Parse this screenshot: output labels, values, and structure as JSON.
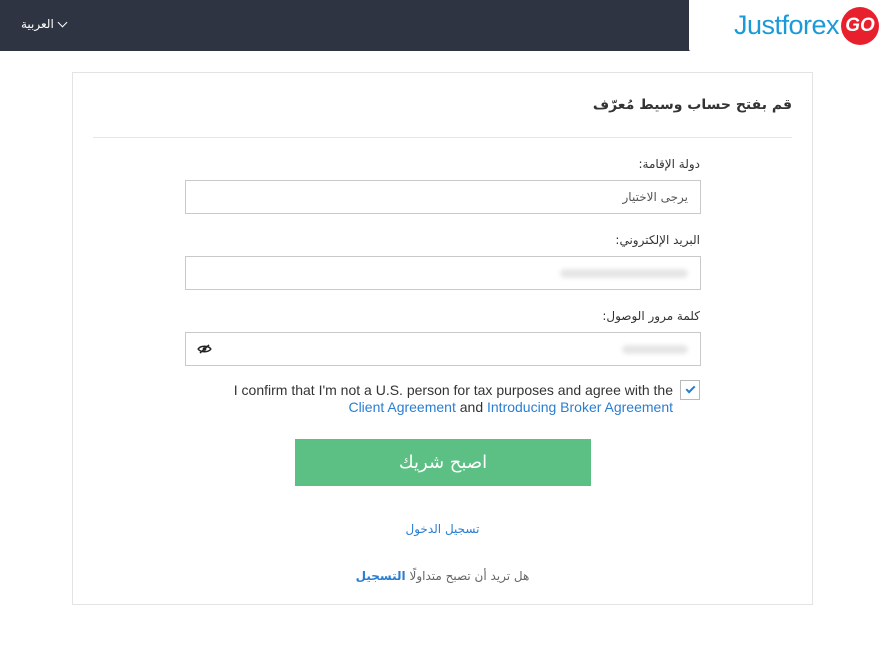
{
  "header": {
    "language": "العربية",
    "logo_text": "Justforex",
    "logo_badge": "GO",
    "brand_color": "#1a9bd7",
    "badge_color": "#e8202e",
    "bar_color": "#2e3441"
  },
  "form": {
    "title": "قم بفتح حساب وسيط مُعرّف",
    "country": {
      "label": "دولة الإقامة:",
      "value": "يرجى الاختيار"
    },
    "email": {
      "label": "البريد الإلكتروني:"
    },
    "password": {
      "label": "كلمة مرور الوصول:",
      "toggle_icon": "eye-slash-icon"
    },
    "confirm": {
      "text_before": "I confirm that I'm not a U.S. person for tax purposes and agree with the",
      "link1": "Client Agreement",
      "and": "and",
      "link2": "Introducing Broker Agreement",
      "checked": true
    },
    "submit_label": "اصبح شريك",
    "submit_color": "#5cc085",
    "login_link": "تسجيل الدخول",
    "register_prompt": "هل تريد أن تصبح متداولًا",
    "register_link": "التسجيل",
    "link_color": "#2a7ed2"
  }
}
